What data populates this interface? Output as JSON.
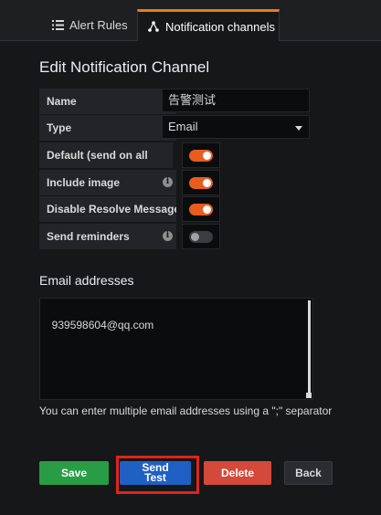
{
  "tabs": {
    "alert_rules": {
      "label": "Alert Rules",
      "icon": "list-icon"
    },
    "notification_channels": {
      "label": "Notification channels",
      "icon": "share-icon"
    }
  },
  "page_title": "Edit Notification Channel",
  "form": {
    "name": {
      "label": "Name",
      "value": "告警测试"
    },
    "type": {
      "label": "Type",
      "value": "Email"
    },
    "default": {
      "label": "Default (send on all",
      "checked": true
    },
    "include_image": {
      "label": "Include image",
      "info": "i",
      "checked": true
    },
    "disable_resolve": {
      "label": "Disable Resolve Message",
      "checked": true
    },
    "send_reminders": {
      "label": "Send reminders",
      "info": "i",
      "checked": false
    }
  },
  "email": {
    "heading": "Email addresses",
    "value": "939598604@qq.com",
    "hint": "You can enter multiple email addresses using a \";\" separator"
  },
  "buttons": {
    "save": "Save",
    "send_test": "Send Test",
    "delete": "Delete",
    "back": "Back"
  },
  "colors": {
    "accent": "#eb7b18",
    "save": "#299c46",
    "send_test": "#1f60c4",
    "delete": "#d44a3a",
    "highlight": "#e1231e"
  }
}
